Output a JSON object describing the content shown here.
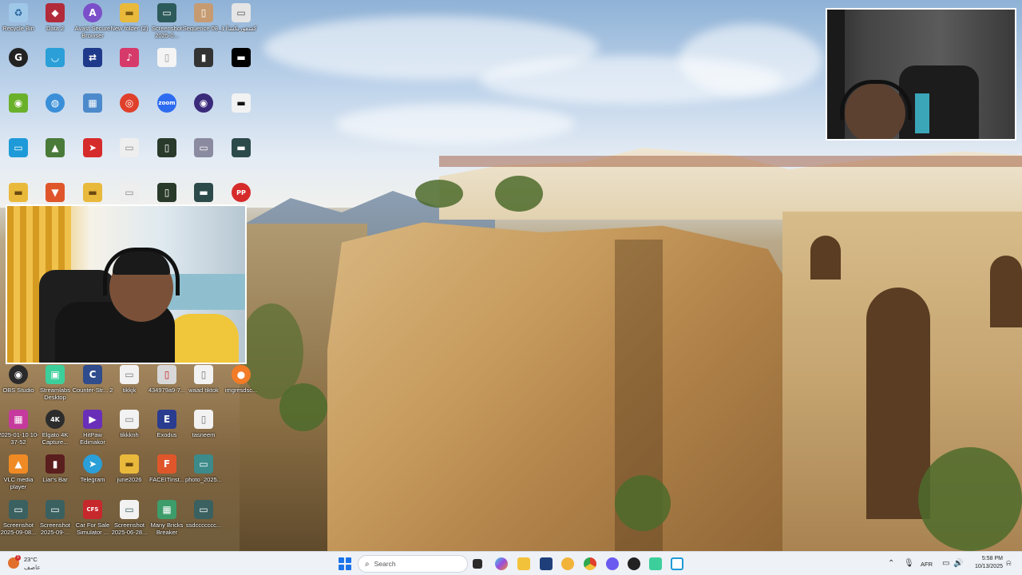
{
  "desktop": {
    "icons": [
      {
        "label": "Recycle Bin",
        "color": "#9fc7e8",
        "glyph": "♻"
      },
      {
        "label": "Data 2",
        "color": "#b22b3a",
        "glyph": "◆"
      },
      {
        "label": "Avast Secure Browser",
        "color": "#7b4fc9",
        "glyph": "A"
      },
      {
        "label": "New folder (2)",
        "color": "#e9b93c",
        "glyph": "▬"
      },
      {
        "label": "Screenshot 2025-0...",
        "color": "#2d5a5a",
        "glyph": "▭"
      },
      {
        "label": "Sequence 08_1",
        "color": "#c69b72",
        "glyph": "▯"
      },
      {
        "label": "كشفوريكشاا",
        "color": "#e5e5e5",
        "glyph": "▭"
      },
      {
        "label": "OBS Studio",
        "color": "#2a2a2a",
        "glyph": "◉"
      },
      {
        "label": "Streamlabs Desktop",
        "color": "#3ccf9c",
        "glyph": "▣"
      },
      {
        "label": "Counter-Str... 2",
        "color": "#2f4c8c",
        "glyph": "C"
      },
      {
        "label": "tikkjk",
        "color": "#f2f2f2",
        "glyph": "▭"
      },
      {
        "label": "434979a9-7...",
        "color": "#d8d8d8",
        "glyph": "▯"
      },
      {
        "label": "waad tiktok",
        "color": "#f2f2f2",
        "glyph": "▯"
      },
      {
        "label": "imgresdsc...",
        "color": "#f27b27",
        "glyph": "●"
      },
      {
        "label": "2025-01-10 10-37-52",
        "color": "#c53a9c",
        "glyph": "▦"
      },
      {
        "label": "Elgato 4K Capture...",
        "color": "#2c2c2c",
        "glyph": "4K"
      },
      {
        "label": "HitPaw Edimakor",
        "color": "#6a2fb8",
        "glyph": "▶"
      },
      {
        "label": "tikkknh",
        "color": "#f2f2f2",
        "glyph": "▭"
      },
      {
        "label": "Exodus",
        "color": "#2a3c8f",
        "glyph": "E"
      },
      {
        "label": "tasneem",
        "color": "#f2f2f2",
        "glyph": "▯"
      },
      {
        "label": "VLC media player",
        "color": "#f08a24",
        "glyph": "▲"
      },
      {
        "label": "Liar's Bar",
        "color": "#5b1e1e",
        "glyph": "▮"
      },
      {
        "label": "Telegram",
        "color": "#2a9fd8",
        "glyph": "➤"
      },
      {
        "label": "june2026",
        "color": "#e9b93c",
        "glyph": "▬"
      },
      {
        "label": "FACEITinst...",
        "color": "#e0562b",
        "glyph": "F"
      },
      {
        "label": "photo_2025...",
        "color": "#3c8a8a",
        "glyph": "▭"
      },
      {
        "label": "Screenshot 2025-09-08...",
        "color": "#3a6060",
        "glyph": "▭"
      },
      {
        "label": "Screenshot 2025-09-...",
        "color": "#3a6060",
        "glyph": "▭"
      },
      {
        "label": "Car For Sale Simulator ...",
        "color": "#c7282c",
        "glyph": "CFS"
      },
      {
        "label": "Screenshot 2025-06-28...",
        "color": "#3a6060",
        "glyph": "▭"
      },
      {
        "label": "Many Bricks Breaker",
        "color": "#3c9c6a",
        "glyph": "▦"
      },
      {
        "label": "ssdccccccc...",
        "color": "#3a6060",
        "glyph": "▭"
      }
    ]
  },
  "taskbar": {
    "weather_temp": "23°C",
    "weather_condition": "عاصف",
    "weather_badge": "1",
    "search_placeholder": "Search",
    "search_icon": "search-icon",
    "language": "AFR",
    "time": "5:58 PM",
    "date": "10/13/2025",
    "start_color": "#1a73e8"
  }
}
